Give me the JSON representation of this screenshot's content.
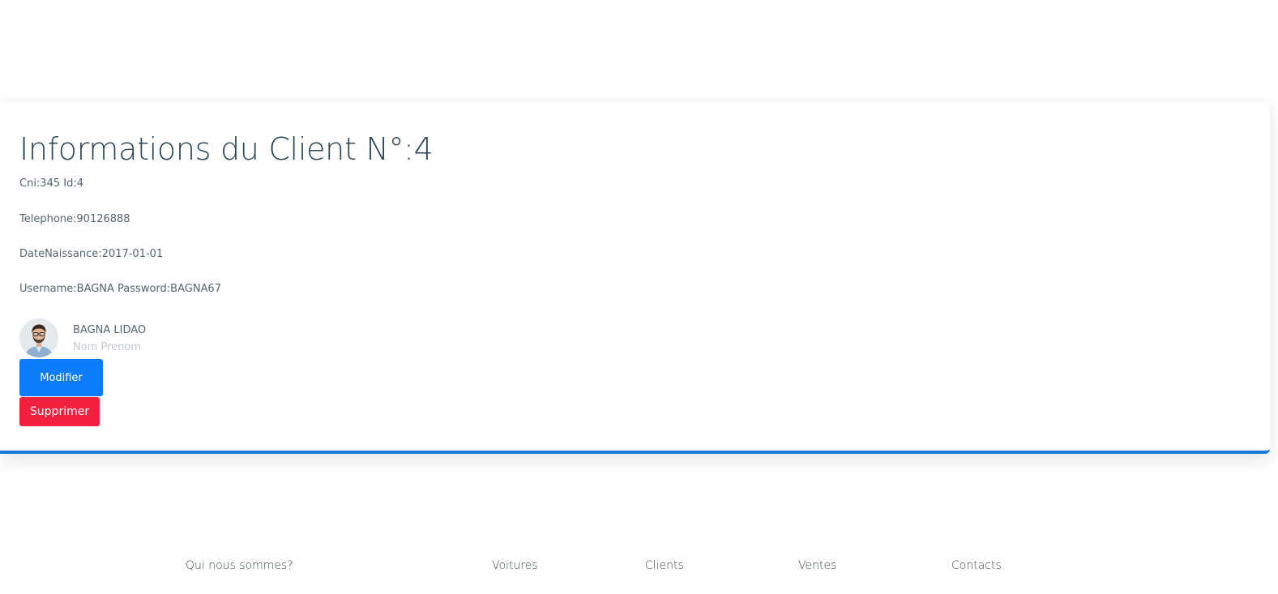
{
  "client_card": {
    "title": "Informations du Client N°:4",
    "cni_line": "Cni:345 Id:4",
    "telephone_line": "Telephone:90126888",
    "birthdate_line": "DateNaissance:2017-01-01",
    "credentials_line": "Username:BAGNA Password:BAGNA67",
    "person": {
      "name": "BAGNA LIDAO",
      "subtitle": "Nom Prenom",
      "avatar_icon": "user-photo"
    },
    "buttons": {
      "modify_label": "Modifier",
      "delete_label": "Supprimer"
    },
    "accent_color": "#1a7bd6"
  },
  "footer": {
    "links": [
      {
        "label": "Qui nous sommes?"
      },
      {
        "label": "Voitures"
      },
      {
        "label": "Clients"
      },
      {
        "label": "Ventes"
      },
      {
        "label": "Contacts"
      }
    ]
  },
  "colors": {
    "modify_button": "#0b7dfa",
    "delete_button": "#f51f3f",
    "title_text": "#2b4656"
  }
}
